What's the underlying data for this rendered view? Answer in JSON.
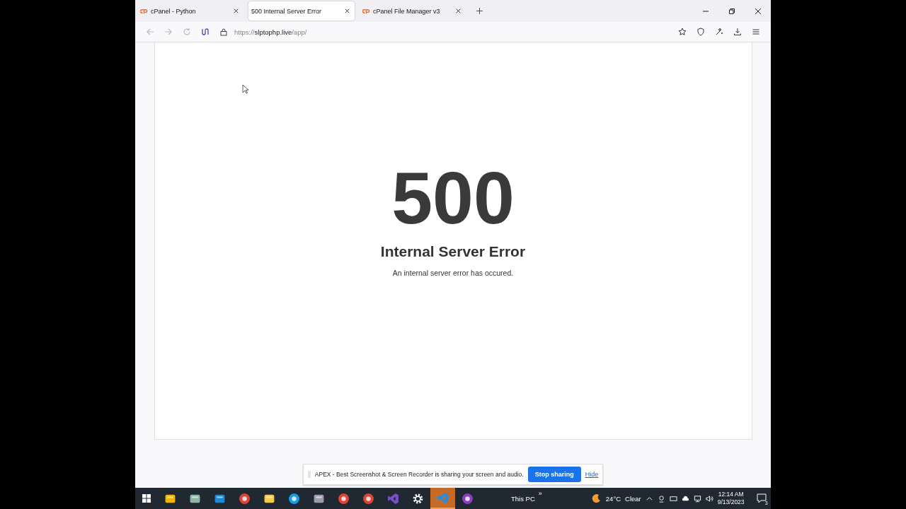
{
  "tabs": [
    {
      "title": "cPanel - Python",
      "kind": "cpanel",
      "selected": false
    },
    {
      "title": "500 Internal Server Error",
      "kind": "plain",
      "selected": true
    },
    {
      "title": "cPanel File Manager v3",
      "kind": "cpanel",
      "selected": false
    }
  ],
  "address": {
    "scheme": "https://",
    "host": "slptophp.live",
    "path": "/app/"
  },
  "page": {
    "code": "500",
    "title": "Internal Server Error",
    "message": "An internal server error has occured."
  },
  "sharing_bar": {
    "message": "APEX - Best Screenshot & Screen Recorder is sharing your screen and audio.",
    "stop_button": "Stop sharing",
    "hide_link": "Hide"
  },
  "taskbar": {
    "apps": [
      {
        "kind": "store",
        "selected": false
      },
      {
        "kind": "notepad",
        "selected": false
      },
      {
        "kind": "mail",
        "selected": false
      },
      {
        "kind": "chrome",
        "selected": false
      },
      {
        "kind": "folder",
        "selected": false
      },
      {
        "kind": "edge",
        "selected": false
      },
      {
        "kind": "monitor",
        "selected": false
      },
      {
        "kind": "chrome",
        "selected": false
      },
      {
        "kind": "chrome",
        "selected": false
      },
      {
        "kind": "vs",
        "selected": false
      },
      {
        "kind": "gear",
        "selected": false
      },
      {
        "kind": "vscode",
        "selected": true
      },
      {
        "kind": "tor",
        "selected": false
      }
    ],
    "toolbar_label": "This PC",
    "toolbar_more": "»",
    "temperature": "24°C",
    "weather": "Clear",
    "time": "12:14 AM",
    "date": "9/13/2023",
    "notifications": "3"
  }
}
